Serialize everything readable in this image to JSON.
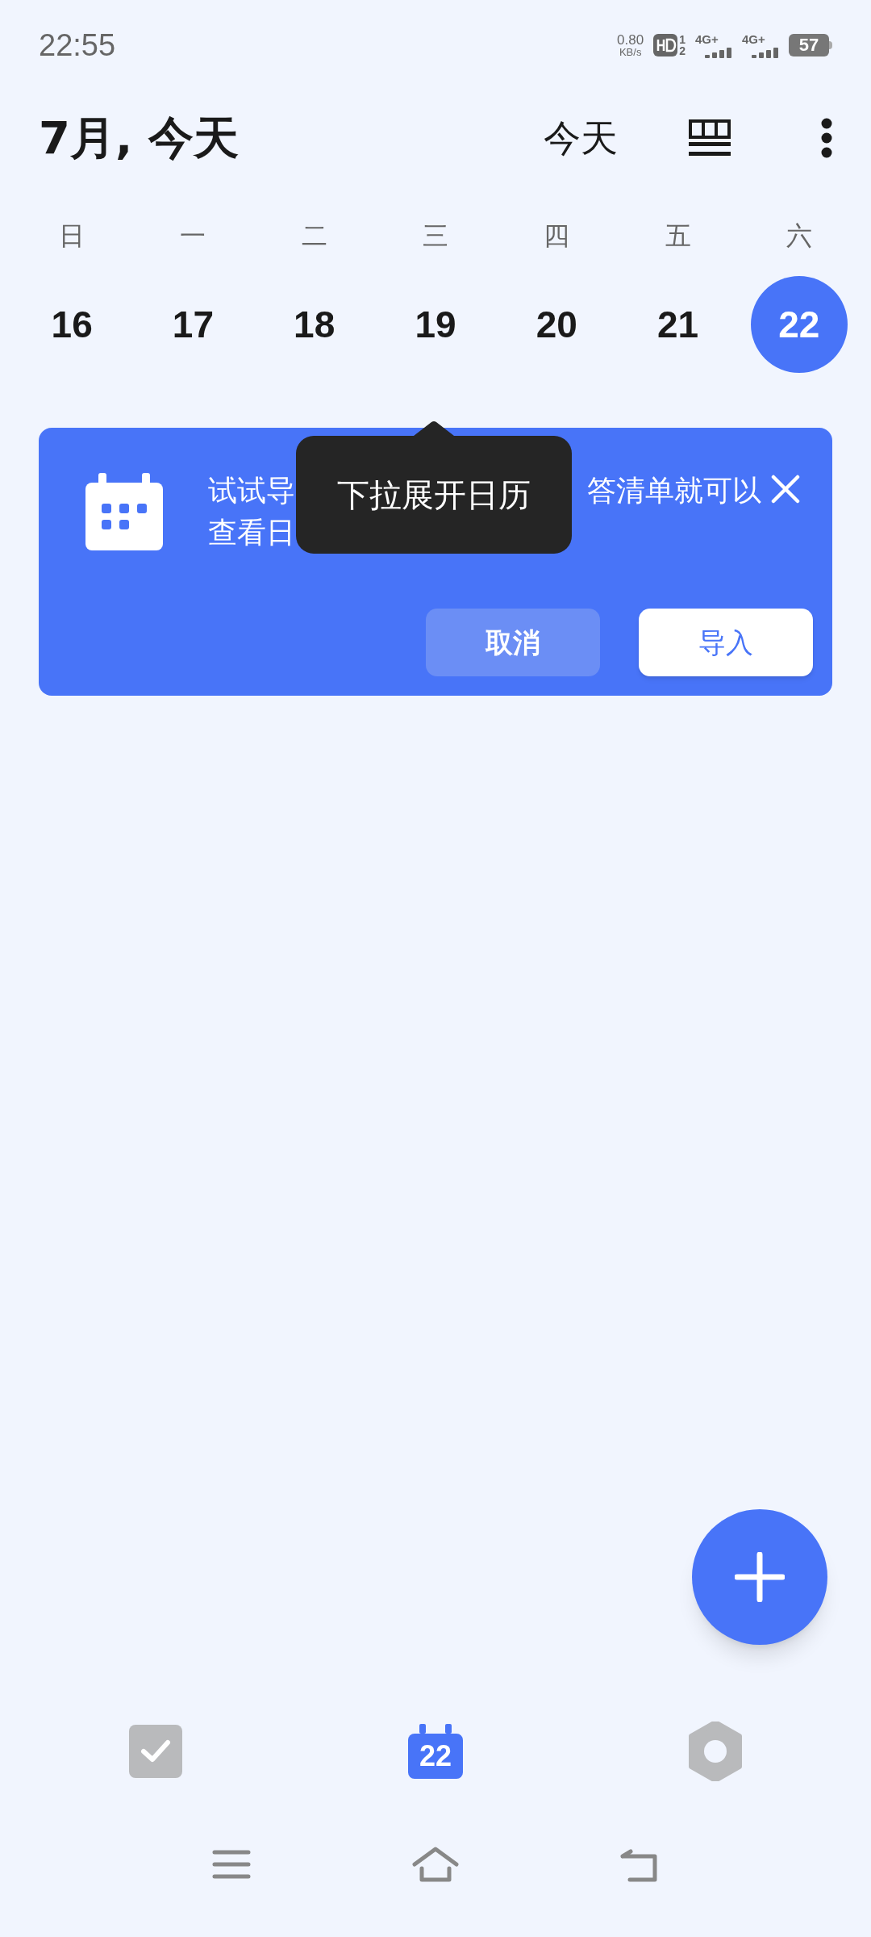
{
  "status_bar": {
    "time": "22:55",
    "net_speed": "0.80",
    "net_unit": "KB/s",
    "hd_sims": [
      "1",
      "2"
    ],
    "networks": [
      "4G+",
      "4G+"
    ],
    "battery": "57"
  },
  "header": {
    "title": "7月, 今天",
    "today_button": "今天"
  },
  "week": [
    {
      "weekday": "日",
      "date": "16",
      "selected": false
    },
    {
      "weekday": "一",
      "date": "17",
      "selected": false
    },
    {
      "weekday": "二",
      "date": "18",
      "selected": false
    },
    {
      "weekday": "三",
      "date": "19",
      "selected": false
    },
    {
      "weekday": "四",
      "date": "20",
      "selected": false
    },
    {
      "weekday": "五",
      "date": "21",
      "selected": false
    },
    {
      "weekday": "六",
      "date": "22",
      "selected": true
    }
  ],
  "banner": {
    "line1_start": "试试导",
    "line1_end": "答清单就可以",
    "line2": "查看日",
    "buttons": [
      {
        "label": "取消",
        "kind": "secondary"
      },
      {
        "label": "导入",
        "kind": "primary"
      }
    ]
  },
  "tooltip": "下拉展开日历",
  "bottom_nav": [
    {
      "kind": "tasks",
      "selected": false
    },
    {
      "kind": "calendar",
      "label": "22",
      "selected": true
    },
    {
      "kind": "settings",
      "selected": false
    }
  ]
}
